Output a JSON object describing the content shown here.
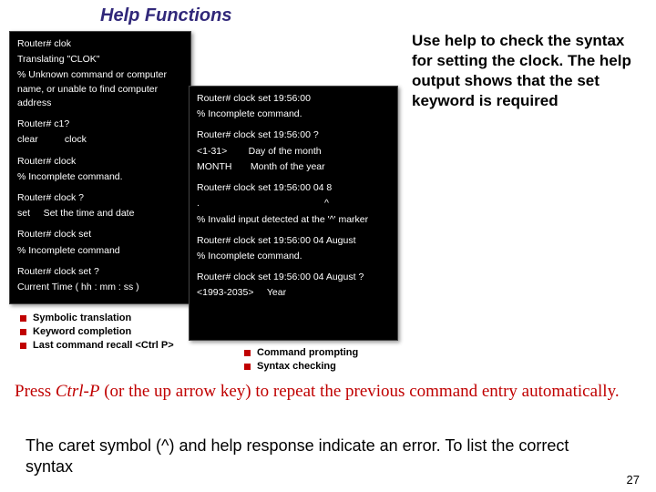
{
  "title": "Help Functions",
  "leftTerm": {
    "b1l1": "Router# clok",
    "b1l2": "Translating \"CLOK\"",
    "b1l3": "% Unknown command or computer name, or unable to find computer address",
    "b2l1": "Router# c1?",
    "b2l2": "clear          clock",
    "b3l1": "Router# clock",
    "b3l2": "% Incomplete command.",
    "b4l1": "Router# clock ?",
    "b4l2": "set     Set the time and date",
    "b5l1": "Router# clock set",
    "b5l2": "% Incomplete command",
    "b6l1": "Router# clock set ?",
    "b6l2": "Current Time ( hh : mm : ss )"
  },
  "rightTerm": {
    "b1l1": "Router# clock set 19:56:00",
    "b1l2": "% Incomplete command.",
    "b2l1": "Router# clock set 19:56:00 ?",
    "b2l2": "<1-31>        Day of the month",
    "b2l3": "MONTH       Month of the year",
    "b3l1": "Router# clock set 19:56:00 04 8",
    "b3l2": ".                                               ^",
    "b3l3": "% Invalid input detected at the '^' marker",
    "b4l1": "Router# clock set 19:56:00 04 August",
    "b4l2": "% Incomplete command.",
    "b5l1": "Router# clock set 19:56:00 04 August ?",
    "b5l2": "<1993-2035>     Year"
  },
  "bulletsLeft": [
    "Symbolic translation",
    "Keyword completion",
    "Last command recall <Ctrl P>"
  ],
  "bulletsRight": [
    "Command prompting",
    "Syntax checking"
  ],
  "explain": "Use help to check the syntax for setting the clock. The help output shows that the set keyword is required",
  "redNote_a": "Press ",
  "redNote_b": "Ctrl-P",
  "redNote_c": " (or the up arrow key) to repeat the previous command entry automatically.",
  "caretNote": "The caret symbol (^) and help response indicate an error. To list the correct syntax",
  "pageNum": "27"
}
